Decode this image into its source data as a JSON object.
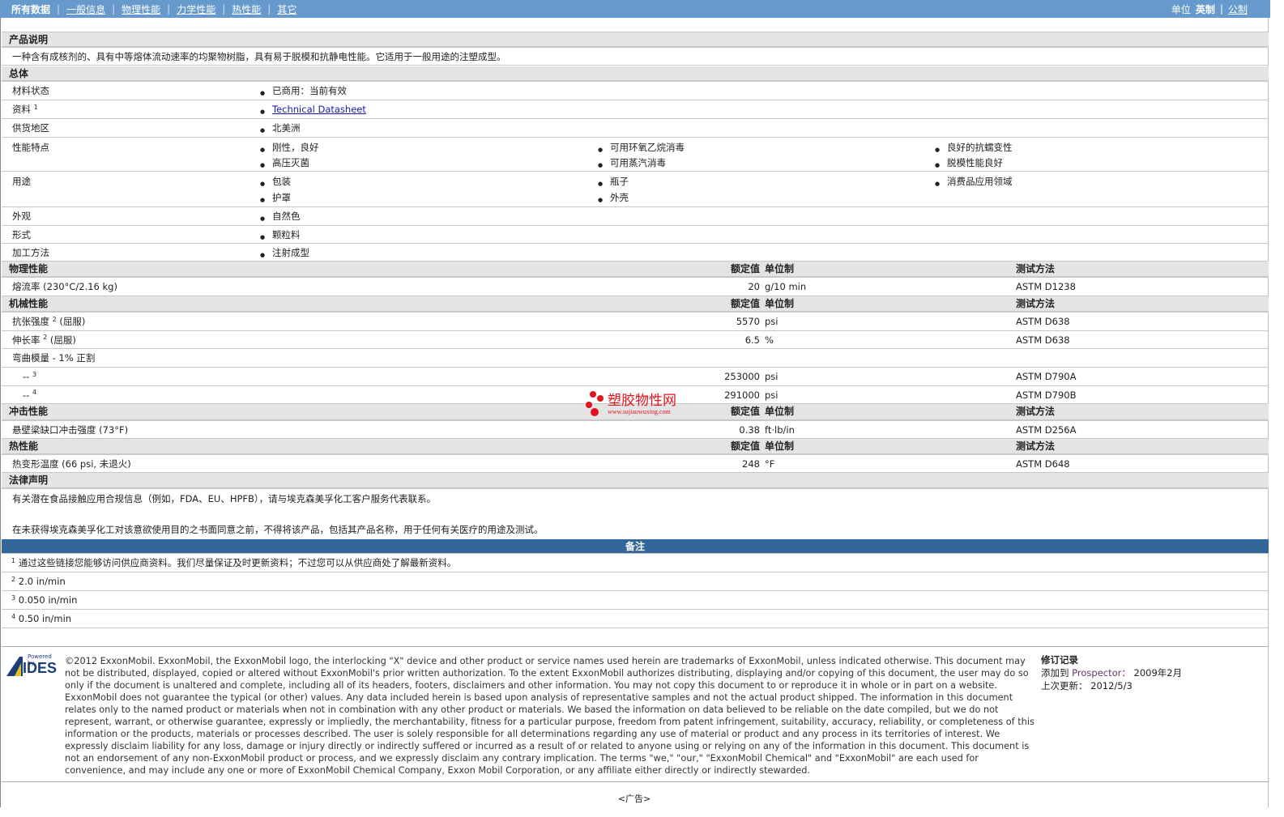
{
  "nav": {
    "tabs": [
      "所有数据",
      "一般信息",
      "物理性能",
      "力学性能",
      "热性能",
      "其它"
    ],
    "units_label": "单位",
    "unit_imperial": "英制",
    "unit_metric": "公制"
  },
  "product": {
    "header": "产品说明",
    "description": "一种含有成核剂的、具有中等熔体流动速率的均聚物树脂，具有易于脱模和抗静电性能。它适用于一般用途的注塑成型。"
  },
  "general": {
    "header": "总体",
    "rows": [
      {
        "label": "材料状态",
        "items": [
          "已商用：当前有效"
        ]
      },
      {
        "label": "资料",
        "sup": "1",
        "items": [
          "Technical Datasheet"
        ]
      },
      {
        "label": "供货地区",
        "items": [
          "北美洲"
        ]
      },
      {
        "label": "性能特点",
        "items": [
          "刚性，良好",
          "可用环氧乙烷消毒",
          "良好的抗蠕变性",
          "高压灭菌",
          "可用蒸汽消毒",
          "脱模性能良好"
        ]
      },
      {
        "label": "用途",
        "items": [
          "包装",
          "瓶子",
          "消费品应用领域",
          "护罩",
          "外壳"
        ]
      },
      {
        "label": "外观",
        "items": [
          "自然色"
        ]
      },
      {
        "label": "形式",
        "items": [
          "颗粒料"
        ]
      },
      {
        "label": "加工方法",
        "items": [
          "注射成型"
        ]
      }
    ]
  },
  "columns": {
    "value": "额定值",
    "unit": "单位制",
    "method": "测试方法"
  },
  "physical": {
    "header": "物理性能",
    "rows": [
      {
        "label": "熔流率",
        "cond": "(230°C/2.16 kg)",
        "value": "20",
        "unit": "g/10 min",
        "method": "ASTM D1238"
      }
    ]
  },
  "mechanical": {
    "header": "机械性能",
    "rows": [
      {
        "label": "抗张强度",
        "sup": "2",
        "cond": "(屈服)",
        "value": "5570",
        "unit": "psi",
        "method": "ASTM D638"
      },
      {
        "label": "伸长率",
        "sup": "2",
        "cond": "(屈服)",
        "value": "6.5",
        "unit": "%",
        "method": "ASTM D638"
      },
      {
        "label": "弯曲模量",
        "cond": "- 1% 正割"
      },
      {
        "label": "--",
        "sup": "3",
        "value": "253000",
        "unit": "psi",
        "method": "ASTM D790A"
      },
      {
        "label": "--",
        "sup": "4",
        "value": "291000",
        "unit": "psi",
        "method": "ASTM D790B"
      }
    ]
  },
  "impact": {
    "header": "冲击性能",
    "rows": [
      {
        "label": "悬壁梁缺口冲击强度",
        "cond": "(73°F)",
        "value": "0.38",
        "unit": "ft·lb/in",
        "method": "ASTM D256A"
      }
    ]
  },
  "thermal": {
    "header": "热性能",
    "rows": [
      {
        "label": "热变形温度",
        "cond": "(66 psi, 未退火)",
        "value": "248",
        "unit": "°F",
        "method": "ASTM D648"
      }
    ]
  },
  "legal": {
    "header": "法律声明",
    "p1": "有关潜在食品接触应用合规信息（例如，FDA、EU、HPFB），请与埃克森美孚化工客户服务代表联系。",
    "p2": "在未获得埃克森美孚化工对该意欲使用目的之书面同意之前，不得将该产品，包括其产品名称，用于任何有关医疗的用途及测试。"
  },
  "notes": {
    "header": "备注",
    "items": [
      {
        "n": "1",
        "text": "通过这些链接您能够访问供应商资料。我们尽量保证及时更新资料；不过您可以从供应商处了解最新资料。"
      },
      {
        "n": "2",
        "text": "2.0 in/min"
      },
      {
        "n": "3",
        "text": "0.050 in/min"
      },
      {
        "n": "4",
        "text": "0.50 in/min"
      }
    ]
  },
  "footer": {
    "logo_top": "Powered by",
    "logo": "IDES",
    "legal": "©2012 ExxonMobil. ExxonMobil, the ExxonMobil logo, the interlocking \"X\" device and other product or service names used herein are trademarks of ExxonMobil, unless indicated otherwise. This document may not be distributed, displayed, copied or altered without ExxonMobil's prior written authorization. To the extent ExxonMobil authorizes distributing, displaying and/or copying of this document, the user may do so only if the document is unaltered and complete, including all of its headers, footers, disclaimers and other information. You may not copy this document to or reproduce it in whole or in part on a website. ExxonMobil does not guarantee the typical (or other) values. Any data included herein is based upon analysis of representative samples and not the actual product shipped. The information in this document relates only to the named product or materials when not in combination with any other product or materials. We based the information on data believed to be reliable on the date compiled, but we do not represent, warrant, or otherwise guarantee, expressly or impliedly, the merchantability, fitness for a particular purpose, freedom from patent infringement, suitability, accuracy, reliability, or completeness of this information or the products, materials or processes described. The user is solely responsible for all determinations regarding any use of material or product and any process in its territories of interest. We expressly disclaim liability for any loss, damage or injury directly or indirectly suffered or incurred as a result of or related to anyone using or relying on any of the information in this document. This document is not an endorsement of any non-ExxonMobil product or process, and we expressly disclaim any contrary implication. The terms \"we,\" \"our,\" \"ExxonMobil Chemical\" and \"ExxonMobil\" are each used for convenience, and may include any one or more of ExxonMobil Chemical Company, Exxon Mobil Corporation, or any affiliate either directly or indirectly stewarded.",
    "rev_title": "修订记录",
    "added_label": "添加到",
    "prospector": "Prospector：",
    "added_date": "2009年2月",
    "updated_label": "上次更新：",
    "updated_date": "2012/5/3"
  },
  "watermark": {
    "name": "塑胶物性网",
    "url": "www.sujiaowuxing.com"
  },
  "ad": "<广告>"
}
